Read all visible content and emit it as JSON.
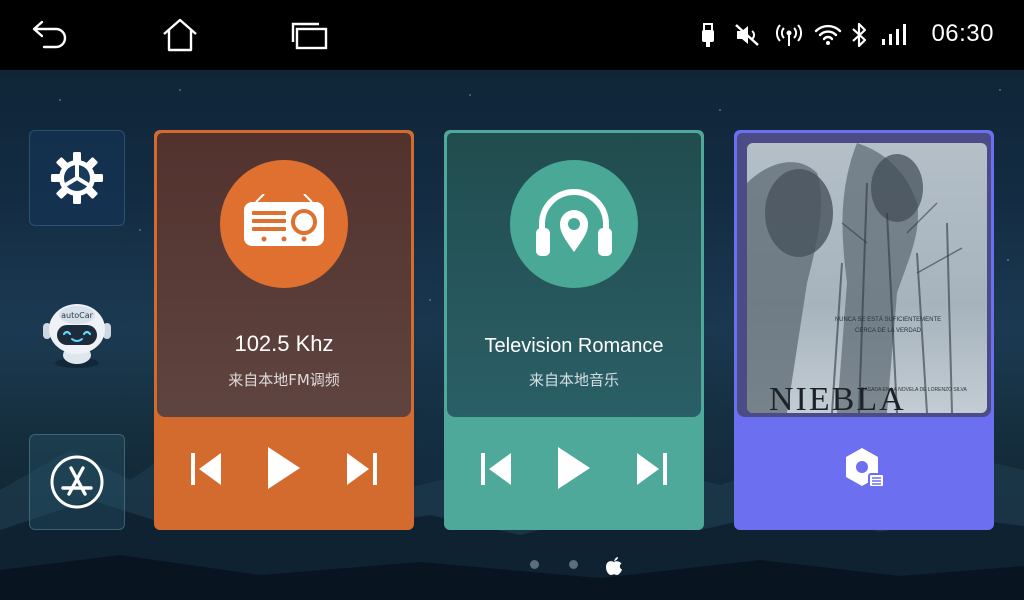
{
  "status_bar": {
    "back_icon": "back-arrow-icon",
    "home_icon": "home-icon",
    "recents_icon": "recent-apps-icon",
    "indicators": [
      "usb-icon",
      "mute-icon",
      "hotspot-icon",
      "wifi-icon",
      "bluetooth-icon",
      "signal-icon"
    ],
    "time": "06:30"
  },
  "sidebar": {
    "items": [
      {
        "name": "settings",
        "icon": "gear-icon"
      },
      {
        "name": "assistant",
        "icon": "robot-icon",
        "badge_text": "autoCar"
      },
      {
        "name": "app-store",
        "icon": "app-store-icon"
      }
    ]
  },
  "cards": {
    "radio": {
      "icon": "radio-icon",
      "title": "102.5 Khz",
      "subtitle": "来自本地FM调频",
      "color": "#d36b2f"
    },
    "music": {
      "icon": "headphones-location-icon",
      "title": "Television Romance",
      "subtitle": "来自本地音乐",
      "color": "#4ea99b"
    },
    "video": {
      "poster_title": "NIEBLA",
      "poster_tagline": "NUNCA SE ESTÁ SUFICIENTEMENTE CERCA DE LA VERDAD",
      "poster_credit": "BASADA EN LA NOVELA DE LORENZO SILVA",
      "app_icon": "video-player-icon",
      "color": "#6b6ff0"
    }
  },
  "page_indicator": {
    "count": 3,
    "active": 3,
    "active_icon": "apple-icon"
  }
}
